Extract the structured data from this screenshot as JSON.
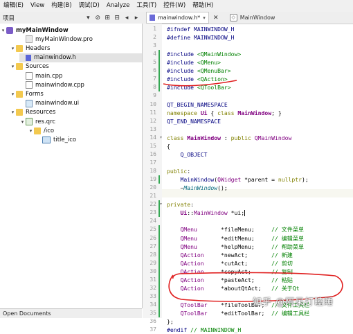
{
  "menu": [
    "编辑(E)",
    "View",
    "构建(B)",
    "调试(D)",
    "Analyze",
    "工具(T)",
    "控件(W)",
    "帮助(H)"
  ],
  "toolbar": {
    "panel_title": "项目",
    "file_tab": "mainwindow.h*",
    "class_tab": "MainWindow"
  },
  "tree": [
    {
      "label": "myMainWindow",
      "icon": "project-icon",
      "arrow": "▾",
      "bold": true
    },
    {
      "label": "myMainWindow.pro",
      "icon": "pro-file-icon",
      "arrow": ""
    },
    {
      "label": "Headers",
      "icon": "folder-icon",
      "arrow": "▾"
    },
    {
      "label": "mainwindow.h",
      "icon": "header-file-icon",
      "arrow": "",
      "selected": true
    },
    {
      "label": "Sources",
      "icon": "folder-icon",
      "arrow": "▾"
    },
    {
      "label": "main.cpp",
      "icon": "cpp-file-icon",
      "arrow": ""
    },
    {
      "label": "mainwindow.cpp",
      "icon": "cpp-file-icon",
      "arrow": ""
    },
    {
      "label": "Forms",
      "icon": "folder-icon",
      "arrow": "▾"
    },
    {
      "label": "mainwindow.ui",
      "icon": "ui-file-icon",
      "arrow": ""
    },
    {
      "label": "Resources",
      "icon": "folder-icon",
      "arrow": "▾"
    },
    {
      "label": "res.qrc",
      "icon": "qrc-file-icon",
      "arrow": "▾"
    },
    {
      "label": "/ico",
      "icon": "folder-icon",
      "arrow": "▾"
    },
    {
      "label": "title_ico",
      "icon": "image-file-icon",
      "arrow": ""
    }
  ],
  "open_documents": "Open Documents",
  "editor": {
    "first_line": 1,
    "lines": [
      [
        [
          "pp",
          "#ifndef MAINWINDOW_H"
        ]
      ],
      [
        [
          "pp",
          "#define MAINWINDOW_H"
        ]
      ],
      [
        [
          "mac",
          ""
        ]
      ],
      [
        [
          "pp",
          "#include "
        ],
        [
          "inc",
          "<QMainWindow>"
        ]
      ],
      [
        [
          "pp",
          "#include "
        ],
        [
          "inc",
          "<QMenu>"
        ]
      ],
      [
        [
          "pp",
          "#include "
        ],
        [
          "inc",
          "<QMenuBar>"
        ]
      ],
      [
        [
          "pp",
          "#include "
        ],
        [
          "inc",
          "<QAction>"
        ]
      ],
      [
        [
          "pp",
          "#include "
        ],
        [
          "inc",
          "<QToolBar>"
        ]
      ],
      [
        [
          "mac",
          ""
        ]
      ],
      [
        [
          "pp",
          "QT_BEGIN_NAMESPACE"
        ]
      ],
      [
        [
          "kw",
          "namespace "
        ],
        [
          "cls",
          "Ui"
        ],
        [
          "mac",
          " { "
        ],
        [
          "kw",
          "class "
        ],
        [
          "cls",
          "MainWindow"
        ],
        [
          "mac",
          "; }"
        ]
      ],
      [
        [
          "pp",
          "QT_END_NAMESPACE"
        ]
      ],
      [
        [
          "mac",
          ""
        ]
      ],
      [
        [
          "kw",
          "class "
        ],
        [
          "cls",
          "MainWindow"
        ],
        [
          "mac",
          " : "
        ],
        [
          "kw",
          "public "
        ],
        [
          "typ",
          "QMainWindow"
        ]
      ],
      [
        [
          "mac",
          "{"
        ]
      ],
      [
        [
          "pp",
          "    Q_OBJECT"
        ]
      ],
      [
        [
          "mac",
          ""
        ]
      ],
      [
        [
          "kw",
          "public"
        ],
        [
          "mac",
          ":"
        ]
      ],
      [
        [
          "kw2",
          "    MainWindow"
        ],
        [
          "mac",
          "("
        ],
        [
          "typ",
          "QWidget"
        ],
        [
          "mac",
          " *"
        ],
        [
          "var",
          "parent"
        ],
        [
          "mac",
          " = "
        ],
        [
          "kw",
          "nullptr"
        ],
        [
          "mac",
          ");"
        ]
      ],
      [
        [
          "mac",
          "    ~"
        ],
        [
          "itl",
          "MainWindow"
        ],
        [
          "mac",
          "();"
        ]
      ],
      [
        [
          "mac",
          ""
        ]
      ],
      [
        [
          "kw",
          "private"
        ],
        [
          "mac",
          ":"
        ]
      ],
      [
        [
          "mac",
          "    "
        ],
        [
          "cls",
          "Ui"
        ],
        [
          "mac",
          "::"
        ],
        [
          "typ",
          "MainWindow"
        ],
        [
          "mac",
          " *ui;"
        ]
      ],
      [
        [
          "mac",
          ""
        ]
      ],
      [
        [
          "typ",
          "    QMenu"
        ],
        [
          "mac",
          "       *fileMenu;     "
        ],
        [
          "cm",
          "// 文件菜单"
        ]
      ],
      [
        [
          "typ",
          "    QMenu"
        ],
        [
          "mac",
          "       *editMenu;     "
        ],
        [
          "cm",
          "// 编辑菜单"
        ]
      ],
      [
        [
          "typ",
          "    QMenu"
        ],
        [
          "mac",
          "       *helpMenu;     "
        ],
        [
          "cm",
          "// 帮助菜单"
        ]
      ],
      [
        [
          "typ",
          "    QAction"
        ],
        [
          "mac",
          "     *newAct;       "
        ],
        [
          "cm",
          "// 新建"
        ]
      ],
      [
        [
          "typ",
          "    QAction"
        ],
        [
          "mac",
          "     *cutAct;       "
        ],
        [
          "cm",
          "// 剪切"
        ]
      ],
      [
        [
          "typ",
          "    QAction"
        ],
        [
          "mac",
          "     *copyAct;      "
        ],
        [
          "cm",
          "// 复制"
        ]
      ],
      [
        [
          "typ",
          "    QAction"
        ],
        [
          "mac",
          "     *pasteAct;     "
        ],
        [
          "cm",
          "// 粘贴"
        ]
      ],
      [
        [
          "typ",
          "    QAction"
        ],
        [
          "mac",
          "     *aboutQtAct;   "
        ],
        [
          "cm",
          "// 关于Qt"
        ]
      ],
      [
        [
          "mac",
          ""
        ]
      ],
      [
        [
          "typ",
          "    QToolBar"
        ],
        [
          "mac",
          "    *fileToolBar;  "
        ],
        [
          "cm",
          "// 文件工具栏"
        ]
      ],
      [
        [
          "typ",
          "    QToolBar"
        ],
        [
          "mac",
          "    *editToolBar;  "
        ],
        [
          "cm",
          "// 编辑工具栏"
        ]
      ],
      [
        [
          "mac",
          "};"
        ]
      ],
      [
        [
          "pp",
          "#endif "
        ],
        [
          "cm",
          "// MAINWINDOW_H"
        ]
      ]
    ]
  },
  "watermark": "知乎 @阿呆打瞌睡",
  "colors": {
    "annotation": "#e02020",
    "change_bar": "#34a853"
  }
}
